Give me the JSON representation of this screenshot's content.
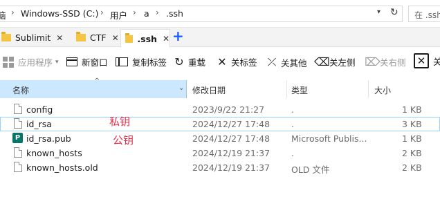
{
  "address": {
    "crumbs": [
      "脑",
      "Windows-SSD (C:)",
      "用户",
      "a",
      ".ssh"
    ],
    "search_placeholder": "在 .ssh"
  },
  "tabs": [
    {
      "label": "Sublimit",
      "active": false
    },
    {
      "label": "CTF",
      "active": false
    },
    {
      "label": ".ssh",
      "active": true
    }
  ],
  "toolbar": {
    "apps": "应用程序",
    "new_window": "新窗口",
    "copy_tab": "复制标签",
    "reload": "重载",
    "close_tab": "关标签",
    "close_others": "关其他",
    "close_left": "关左侧",
    "close_right": "关右侧",
    "close_all": "关"
  },
  "columns": {
    "name": "名称",
    "modified": "修改日期",
    "type": "类型",
    "size": "大小"
  },
  "files": [
    {
      "name": "config",
      "modified": "2023/9/22 21:27",
      "type": ".",
      "size": "1 KB",
      "icon": "file-icon"
    },
    {
      "name": "id_rsa",
      "modified": "2024/12/27 17:48",
      "type": ".",
      "size": "3 KB",
      "icon": "file-icon"
    },
    {
      "name": "id_rsa.pub",
      "modified": "2024/12/27 17:48",
      "type": "Microsoft Publis...",
      "size": "1 KB",
      "icon": "publisher-icon"
    },
    {
      "name": "known_hosts",
      "modified": "2024/12/19 21:37",
      "type": ".",
      "size": "2 KB",
      "icon": "file-icon"
    },
    {
      "name": "known_hosts.old",
      "modified": "2024/12/19 21:37",
      "type": "OLD 文件",
      "size": "2 KB",
      "icon": "file-icon"
    }
  ],
  "annotations": {
    "private_key": "私钥",
    "public_key": "公钥"
  },
  "colors": {
    "selection": "#cce8ff",
    "accent_plus": "#1a5cff",
    "annotation": "#e8304a"
  }
}
